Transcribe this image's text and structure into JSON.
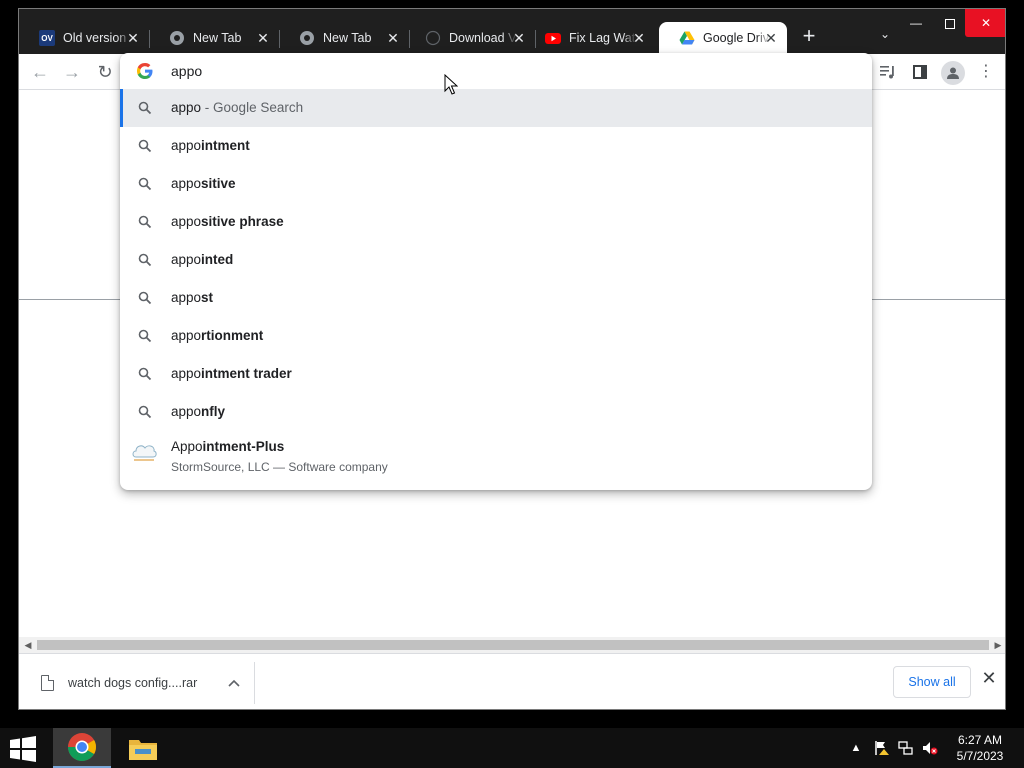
{
  "tabs": [
    {
      "label": "Old version",
      "favicon": "ov-icon"
    },
    {
      "label": "New Tab",
      "favicon": "chrome-tab-icon"
    },
    {
      "label": "New Tab",
      "favicon": "chrome-tab-icon"
    },
    {
      "label": "Download V",
      "favicon": "globe-icon"
    },
    {
      "label": "Fix Lag Wat",
      "favicon": "youtube-icon"
    },
    {
      "label": "Google Driv",
      "favicon": "google-drive-icon",
      "active": true
    }
  ],
  "omnibox": {
    "query": "appo",
    "suggestions": [
      {
        "prefix": "appo",
        "rest": "",
        "suffix": " - Google Search",
        "selected": true
      },
      {
        "prefix": "appo",
        "rest": "intment"
      },
      {
        "prefix": "appo",
        "rest": "sitive"
      },
      {
        "prefix": "appo",
        "rest": "sitive phrase"
      },
      {
        "prefix": "appo",
        "rest": "inted"
      },
      {
        "prefix": "appo",
        "rest": "st"
      },
      {
        "prefix": "appo",
        "rest": "rtionment"
      },
      {
        "prefix": "appo",
        "rest": "intment trader"
      },
      {
        "prefix": "appo",
        "rest": "nfly"
      }
    ],
    "entity": {
      "prefix": "Appo",
      "rest": "intment-Plus",
      "subtitle": "StormSource, LLC — Software company"
    }
  },
  "downloads": {
    "file_name": "watch dogs config....rar",
    "show_all_label": "Show all"
  },
  "taskbar": {
    "time": "6:27 AM",
    "date": "5/7/2023"
  },
  "colors": {
    "accent": "#1a73e8",
    "tabstrip": "#1f1f1f",
    "close_button": "#e81123"
  }
}
